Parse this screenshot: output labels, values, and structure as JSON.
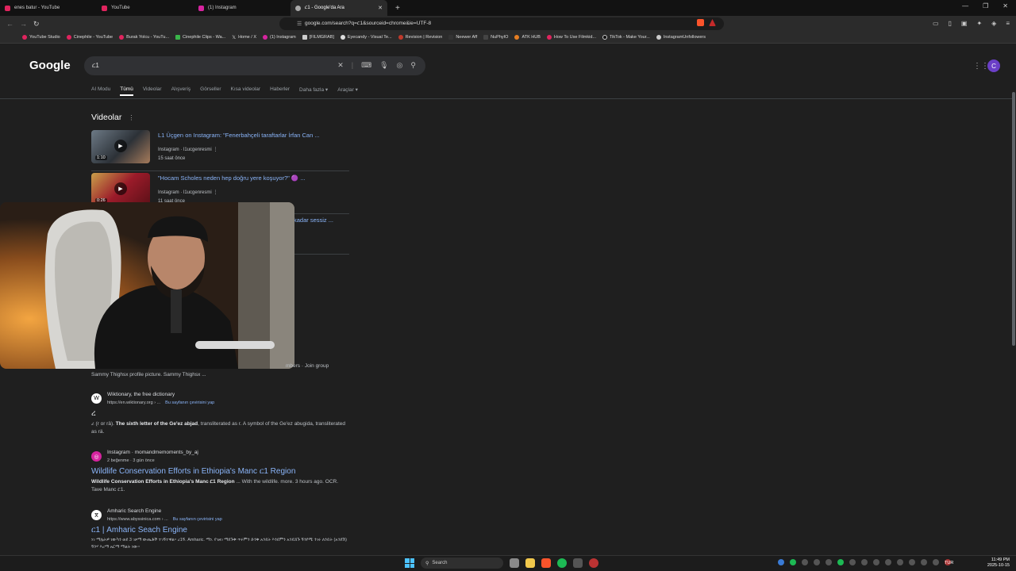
{
  "browser": {
    "tabs": [
      {
        "label": "enes batur - YouTube",
        "color": "#e0245e"
      },
      {
        "label": "YouTube",
        "color": "#e0245e"
      },
      {
        "label": "(1) Instagram",
        "color": "#d6249f"
      },
      {
        "label": "ር1 - Google'da Ara",
        "color": "#aaaaaa"
      }
    ],
    "new_tab": "+",
    "url": "google.com/search?q=ር1&sourceid=chrome&ie=UTF-8",
    "bookmarks": [
      "YouTube Studio",
      "Cinephile - YouTube",
      "Burak Yolcu - YouTu...",
      "Cinephile Clips - Wa...",
      "Home / X",
      "(1) Instagram",
      "[FILMGRAB]",
      "Eyecandy - Visual Te...",
      "Revision | Revision",
      "Neewer Aff",
      "NuPhyIO",
      "ATK HUB",
      "How To Use Filmkid...",
      "TikTok - Make Your...",
      "InstagramUnfollowers"
    ]
  },
  "google": {
    "logo": "Google",
    "query": "ር1",
    "avatar_letter": "C",
    "filters": [
      "AI Modu",
      "Tümü",
      "Videolar",
      "Alışveriş",
      "Görseller",
      "Kısa videolar",
      "Haberler",
      "Daha fazla",
      "Araçlar"
    ],
    "videos_title": "Videolar",
    "videos": [
      {
        "title": "L1 Üçgen on Instagram: \"Fenerbahçeli taraftarlar İrfan Can ...",
        "source": "Instagram",
        "channel": "l1ucgenresmi",
        "time": "15 saat önce",
        "duration": "1:10"
      },
      {
        "title": "\"Hocam Scholes neden hep doğru yere koşuyor?\" 🟣 ...",
        "source": "Instagram",
        "channel": "l1ucgenresmi",
        "time": "11 saat önce",
        "duration": "0:26"
      }
    ],
    "partial_title": "kadar sessiz ...",
    "group_snip": "mbers · Join group",
    "group_snip2": "Sammy Thighsx profile picture. Sammy Thighsx ...",
    "results": [
      {
        "site": "Wiktionary, the free dictionary",
        "url": "https://en.wiktionary.org › ...",
        "translate": "Bu sayfanın çevirisini yap",
        "title": "ረ",
        "body_pre": "ረ (r or rä). ",
        "body_bold": "The sixth letter of the Ge'ez abjad",
        "body_post": ", transliterated as r. A symbol of the Ge'ez abugida, transliterated as rä.",
        "logo": "W"
      },
      {
        "site": "Instagram · momandmemoments_by_aj",
        "url": "2 beğenme · 3 gün önce",
        "title": "Wildlife Conservation Efforts in Ethiopia's Manc ር1 Region",
        "body_bold": "Wildlife Conservation Efforts in Ethiopia's Manc ር1 Region",
        "body_post": " ... With the wildlife. more. 3 hours ago. OCR. Tave Manc ር1.",
        "logo": "◎"
      },
      {
        "site": "Amharic Search Engine",
        "url": "https://www.abyssinica.com › ...",
        "translate": "Bu sayfanın çevirisini yap",
        "title": "ር1 | Amharic Seach Engine",
        "body_post": "ነገ ማሌትዎ ነውካን ወደ 3 ገጾማ ውጤቶች ተገኝተዋል። ረ1ኝ. Amharic. ማነ. የገዘገ ማደጉቅ ጥሩምን ድንቅ አንዴት እንደምን አንዴሸጉ ኝንየሚ ንገሩ ለንዴት (አንደሽ) ኝንሃ እረማ አርማ ማልት ነው።",
        "logo": "ⴳ"
      }
    ]
  },
  "taskbar": {
    "search": "Search",
    "lang": "TUR",
    "time": "11:49 PM",
    "date": "2025-10-15"
  }
}
